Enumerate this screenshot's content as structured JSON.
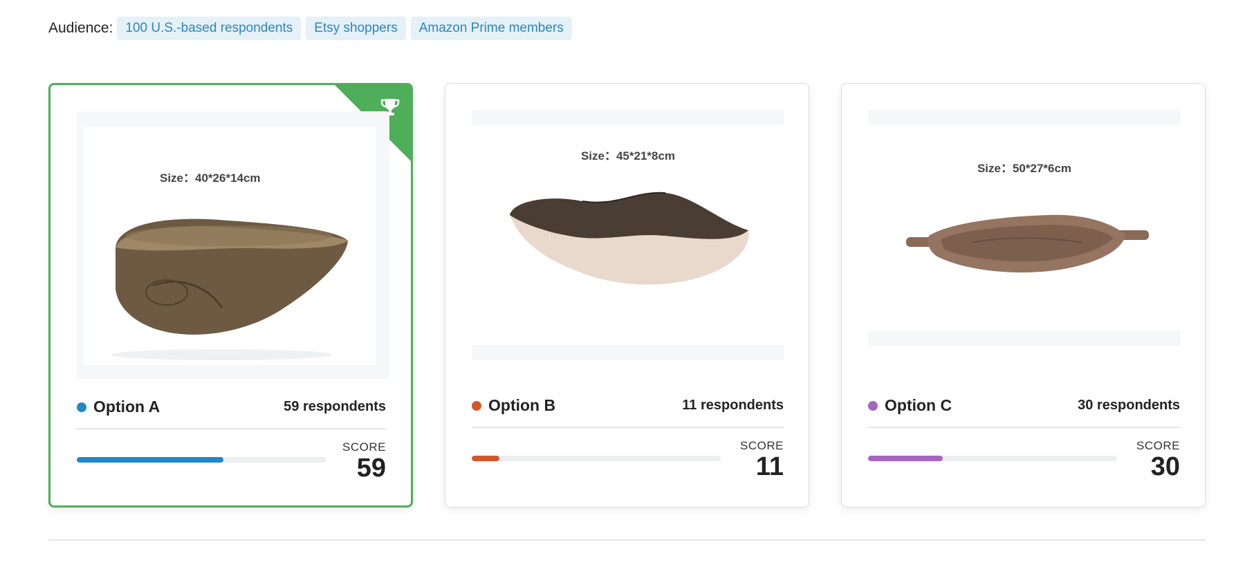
{
  "audience": {
    "label": "Audience:",
    "chips": [
      "100 U.S.-based respondents",
      "Etsy shoppers",
      "Amazon Prime members"
    ]
  },
  "options": [
    {
      "name": "Option A",
      "respondents": "59 respondents",
      "score_label": "SCORE",
      "score": "59",
      "score_fraction": 0.59,
      "color": "#1e88c8",
      "size_text": "Size：40*26*14cm",
      "winner": true,
      "icon": "trophy-icon"
    },
    {
      "name": "Option B",
      "respondents": "11 respondents",
      "score_label": "SCORE",
      "score": "11",
      "score_fraction": 0.11,
      "color": "#d2582c",
      "size_text": "Size：45*21*8cm",
      "winner": false
    },
    {
      "name": "Option C",
      "respondents": "30 respondents",
      "score_label": "SCORE",
      "score": "30",
      "score_fraction": 0.3,
      "color": "#a566c2",
      "size_text": "Size：50*27*6cm",
      "winner": false
    }
  ]
}
